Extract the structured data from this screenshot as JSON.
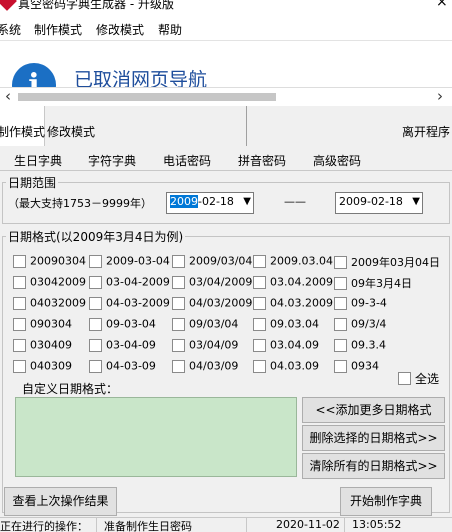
{
  "window": {
    "title": "真空密码字典生成器 - 升级版",
    "close": "×"
  },
  "menu": {
    "items": [
      "系统",
      "制作模式",
      "修改模式",
      "帮助"
    ]
  },
  "banner": {
    "icon": "info-icon",
    "message": "已取消网页导航"
  },
  "toolbar": {
    "make_mode": "制作模式",
    "edit_mode": "修改模式",
    "exit": "离开程序"
  },
  "tabs": [
    "生日字典",
    "字符字典",
    "电话密码",
    "拼音密码",
    "高级密码"
  ],
  "date_range": {
    "legend": "日期范围",
    "support": "（最大支持1753－9999年）",
    "start": {
      "sel": "2009",
      "rest": "-02-18"
    },
    "separator": "——",
    "end": "2009-02-18"
  },
  "date_format": {
    "legend": "日期格式(以2009年3月4日为例)",
    "rows": [
      [
        "20090304",
        "2009-03-04",
        "2009/03/04",
        "2009.03.04",
        "2009年03月04日"
      ],
      [
        "03042009",
        "03-04-2009",
        "03/04/2009",
        "03.04.2009",
        "09年3月4日"
      ],
      [
        "04032009",
        "04-03-2009",
        "04/03/2009",
        "04.03.2009",
        "09-3-4"
      ],
      [
        "090304",
        "09-03-04",
        "09/03/04",
        "09.03.04",
        "09/3/4"
      ],
      [
        "030409",
        "03-04-09",
        "03/04/09",
        "03.04.09",
        "09.3.4"
      ],
      [
        "040309",
        "04-03-09",
        "04/03/09",
        "04.03.09",
        "0934"
      ]
    ],
    "select_all": "全选",
    "custom_label": "自定义日期格式：",
    "add_button": "<<添加更多日期格式",
    "delete_button": "删除选择的日期格式>>",
    "clear_button": "清除所有的日期格式>>"
  },
  "bottom": {
    "view_last": "查看上次操作结果",
    "start": "开始制作字典"
  },
  "status": {
    "label": "正在进行的操作：",
    "value": "准备制作生日密码",
    "date": "2020-11-02",
    "time": "13:05:52"
  },
  "colors": {
    "custom_area": "#c9e6c9",
    "selection": "#0078d7",
    "banner_text": "#1f4e9c"
  }
}
